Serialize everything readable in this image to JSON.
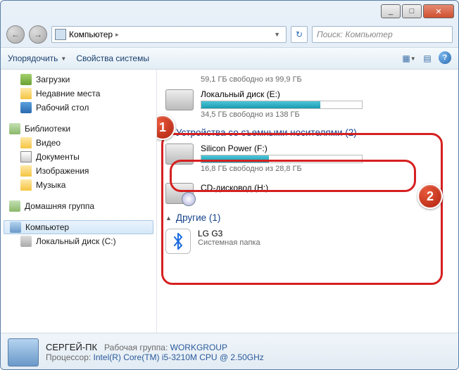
{
  "titlebar": {
    "min": "_",
    "max": "□",
    "close": "✕"
  },
  "nav": {
    "back": "←",
    "fwd": "→"
  },
  "address": {
    "path": "Компьютер",
    "sep": "▸",
    "drop": "▼",
    "refresh": "↻"
  },
  "search": {
    "placeholder": "Поиск: Компьютер"
  },
  "toolbar": {
    "organize": "Упорядочить",
    "properties": "Свойства системы",
    "drop": "▼"
  },
  "sidebar": {
    "downloads": "Загрузки",
    "recent": "Недавние места",
    "desktop": "Рабочий стол",
    "libraries": "Библиотеки",
    "video": "Видео",
    "documents": "Документы",
    "pictures": "Изображения",
    "music": "Музыка",
    "homegroup": "Домашняя группа",
    "computer": "Компьютер",
    "localdisk_c": "Локальный диск (C:)"
  },
  "content": {
    "drive_top_sub": "59,1 ГБ свободно из 99,9 ГБ",
    "drive_e_title": "Локальный диск (E:)",
    "drive_e_sub": "34,5 ГБ свободно из 138 ГБ",
    "drive_e_fill_pct": 74,
    "group_removable": "Устройства со съемными носителями (2)",
    "drive_f_title": "Silicon Power (F:)",
    "drive_f_sub": "16,8 ГБ свободно из 28,8 ГБ",
    "drive_f_fill_pct": 42,
    "drive_cd_title": "CD-дисковод (H:)",
    "group_other": "Другие (1)",
    "lg_title": "LG G3",
    "lg_sub": "Системная папка"
  },
  "annot": {
    "one": "1",
    "two": "2"
  },
  "status": {
    "name": "СЕРГЕЙ-ПК",
    "wg_label": "Рабочая группа:",
    "wg_value": "WORKGROUP",
    "cpu_label": "Процессор:",
    "cpu_value": "Intel(R) Core(TM) i5-3210M CPU @ 2.50GHz"
  }
}
